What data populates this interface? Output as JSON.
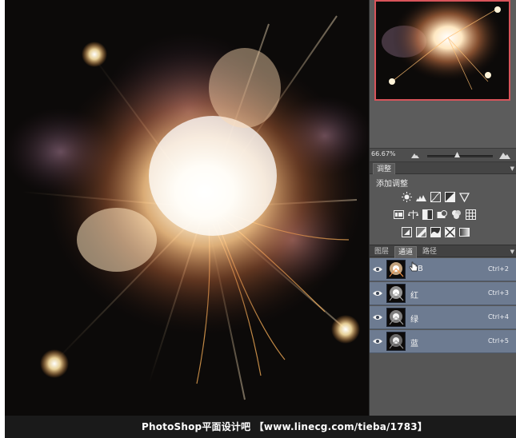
{
  "navigator": {
    "zoom": "66.67%",
    "zoom_out_icon": "mountain-small-icon",
    "zoom_in_icon": "mountain-large-icon"
  },
  "adjustments": {
    "tab_label": "调整",
    "title": "添加调整",
    "icons_row1": [
      "brightness-contrast-icon",
      "levels-icon",
      "curves-icon",
      "exposure-icon",
      "vibrance-icon"
    ],
    "icons_row2": [
      "hue-saturation-icon",
      "color-balance-icon",
      "black-white-icon",
      "photo-filter-icon",
      "channel-mixer-icon",
      "color-lookup-icon"
    ],
    "icons_row3": [
      "invert-icon",
      "posterize-icon",
      "threshold-icon",
      "selective-color-icon",
      "gradient-map-icon"
    ]
  },
  "layers_panel": {
    "tabs": [
      "图层",
      "通道",
      "路径"
    ],
    "active_tab": "通道"
  },
  "channels": [
    {
      "name": "B",
      "shortcut": "Ctrl+2"
    },
    {
      "name": "红",
      "shortcut": "Ctrl+3"
    },
    {
      "name": "绿",
      "shortcut": "Ctrl+4"
    },
    {
      "name": "蓝",
      "shortcut": "Ctrl+5"
    }
  ],
  "watermark": "PhotoShop平面设计吧  【www.linecg.com/tieba/1783】",
  "colors": {
    "panel_bg": "#585858",
    "channel_highlight": "#6d7b91",
    "navigator_frame": "#d8545a"
  }
}
